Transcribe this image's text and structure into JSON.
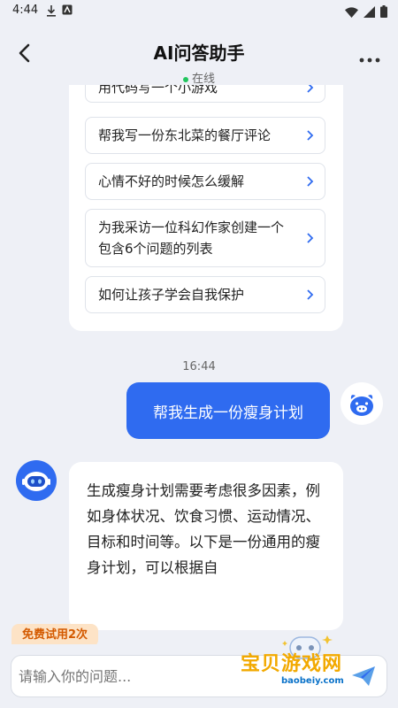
{
  "status_bar": {
    "time": "4:44"
  },
  "header": {
    "title": "AI问答助手",
    "status": "在线"
  },
  "suggestions": [
    {
      "label": "用代码写一个小游戏"
    },
    {
      "label": "帮我写一份东北菜的餐厅评论"
    },
    {
      "label": "心情不好的时候怎么缓解"
    },
    {
      "label": "为我采访一位科幻作家创建一个包含6个问题的列表"
    },
    {
      "label": "如何让孩子学会自我保护"
    }
  ],
  "chat": {
    "timestamp": "16:44",
    "user_message": "帮我生成一份瘦身计划",
    "bot_message": "生成瘦身计划需要考虑很多因素，例如身体状况、饮食习惯、运动情况、目标和时间等。以下是一份通用的瘦身计划，可以根据自"
  },
  "trial_badge": "免费试用2次",
  "input": {
    "placeholder": "请输入你的问题..."
  },
  "watermark": {
    "text": "宝贝游戏网",
    "url": "baobeiy.com"
  },
  "colors": {
    "accent": "#2f6bf0",
    "badge_bg": "#fde3c6",
    "badge_text": "#d45a00",
    "online": "#22c55e"
  },
  "icons": {
    "back": "chevron-left-icon",
    "more": "more-dots-icon",
    "send": "send-icon",
    "chevron": "chevron-right-icon",
    "user_avatar": "pig-avatar-icon",
    "bot_avatar": "robot-avatar-icon"
  }
}
